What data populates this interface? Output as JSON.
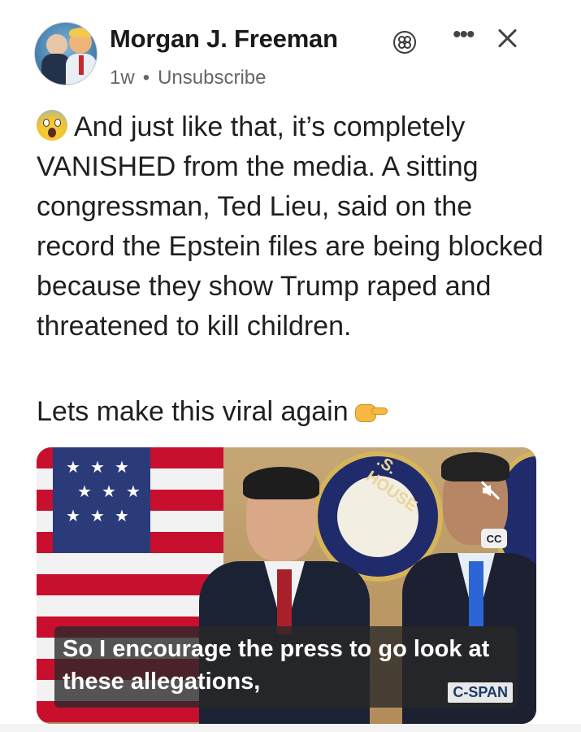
{
  "post": {
    "author": {
      "name": "Morgan J. Freeman",
      "age": "1w",
      "separator": "•",
      "action": "Unsubscribe"
    },
    "body": "And just like that, it’s completely VANISHED from the media. A sitting congressman, Ted Lieu, said on the record the Epstein files are being blocked because they show Trump raped and threatened to kill children.",
    "cta": "Lets make this viral again",
    "icons": [
      "scream-emoji-icon",
      "pointing-hand-emoji-icon",
      "badge-icon",
      "more-icon",
      "close-icon",
      "mute-icon"
    ]
  },
  "video": {
    "caption": "So I encourage the press to go look at these allegations,",
    "cc_label": "CC",
    "logo": "C-SPAN",
    "seal_text": ".S. HOUSE"
  }
}
